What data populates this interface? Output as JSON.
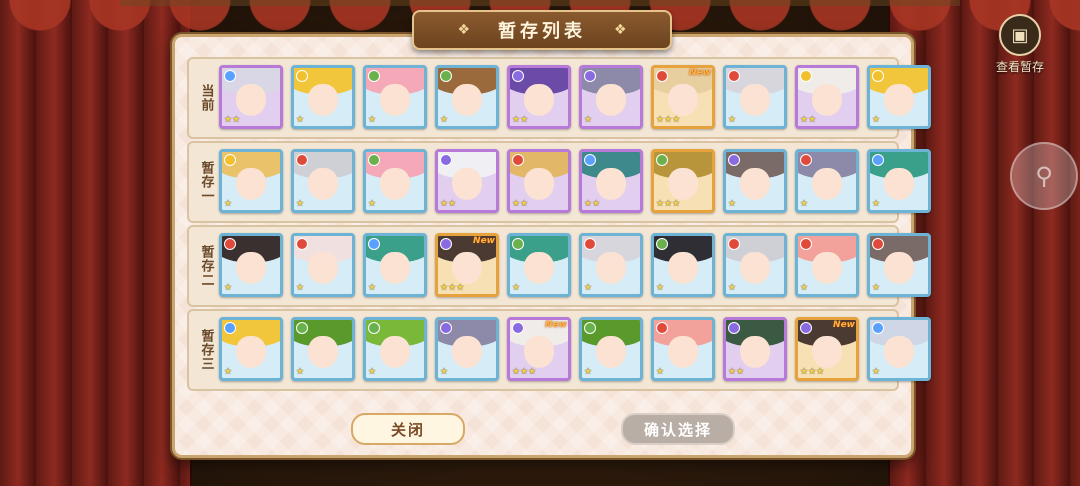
{
  "title": "暂存列表",
  "corner_button": {
    "label": "查看暂存",
    "icon": "storage-box-icon"
  },
  "float_button": {
    "icon": "lock-icon"
  },
  "rows": [
    {
      "label": "当前",
      "cards": [
        {
          "rarity": "purple",
          "element": "#5aa0ff",
          "hair": "#d9d6e6",
          "stars": "★★",
          "new": ""
        },
        {
          "rarity": "blue",
          "element": "#f2c02c",
          "hair": "#f1c63a",
          "stars": "★",
          "new": ""
        },
        {
          "rarity": "blue",
          "element": "#6ab04c",
          "hair": "#f4a8b8",
          "stars": "★",
          "new": ""
        },
        {
          "rarity": "blue",
          "element": "#6ab04c",
          "hair": "#9b6a3c",
          "stars": "★",
          "new": ""
        },
        {
          "rarity": "purple",
          "element": "#8a6ae0",
          "hair": "#6b4aa8",
          "stars": "★★",
          "new": ""
        },
        {
          "rarity": "purple",
          "element": "#8a6ae0",
          "hair": "#8c8aa8",
          "stars": "★",
          "new": ""
        },
        {
          "rarity": "gold",
          "element": "#e04a3a",
          "hair": "#e8cfa0",
          "stars": "★★★",
          "new": "New"
        },
        {
          "rarity": "blue",
          "element": "#e04a3a",
          "hair": "#d6d6dc",
          "stars": "★",
          "new": ""
        },
        {
          "rarity": "purple",
          "element": "#f2c02c",
          "hair": "#f0ecea",
          "stars": "★★",
          "new": ""
        },
        {
          "rarity": "blue",
          "element": "#f2c02c",
          "hair": "#f1c63a",
          "stars": "★",
          "new": ""
        }
      ]
    },
    {
      "label": "暂存一",
      "cards": [
        {
          "rarity": "blue",
          "element": "#f2c02c",
          "hair": "#e9c26a",
          "stars": "★",
          "new": ""
        },
        {
          "rarity": "blue",
          "element": "#e04a3a",
          "hair": "#cfcfd6",
          "stars": "★",
          "new": ""
        },
        {
          "rarity": "blue",
          "element": "#6ab04c",
          "hair": "#f4a8b8",
          "stars": "★",
          "new": ""
        },
        {
          "rarity": "purple",
          "element": "#8a6ae0",
          "hair": "#f0f0f4",
          "stars": "★★",
          "new": ""
        },
        {
          "rarity": "purple",
          "element": "#e04a3a",
          "hair": "#e2b868",
          "stars": "★★",
          "new": ""
        },
        {
          "rarity": "purple",
          "element": "#5aa0ff",
          "hair": "#3e8a8a",
          "stars": "★★",
          "new": ""
        },
        {
          "rarity": "gold",
          "element": "#6ab04c",
          "hair": "#b8943a",
          "stars": "★★★",
          "new": ""
        },
        {
          "rarity": "blue",
          "element": "#8a6ae0",
          "hair": "#7a6a68",
          "stars": "★",
          "new": ""
        },
        {
          "rarity": "blue",
          "element": "#e04a3a",
          "hair": "#8c8aa8",
          "stars": "★",
          "new": ""
        },
        {
          "rarity": "blue",
          "element": "#5aa0ff",
          "hair": "#3aa08a",
          "stars": "★",
          "new": ""
        }
      ]
    },
    {
      "label": "暂存二",
      "cards": [
        {
          "rarity": "blue",
          "element": "#e04a3a",
          "hair": "#3a3030",
          "stars": "★",
          "new": ""
        },
        {
          "rarity": "blue",
          "element": "#e04a3a",
          "hair": "#f0e0e0",
          "stars": "★",
          "new": ""
        },
        {
          "rarity": "blue",
          "element": "#5aa0ff",
          "hair": "#3aa08a",
          "stars": "★",
          "new": ""
        },
        {
          "rarity": "gold",
          "element": "#8a6ae0",
          "hair": "#4a3a32",
          "stars": "★★★",
          "new": "New"
        },
        {
          "rarity": "blue",
          "element": "#6ab04c",
          "hair": "#3aa08a",
          "stars": "★",
          "new": ""
        },
        {
          "rarity": "blue",
          "element": "#e04a3a",
          "hair": "#d6d6dc",
          "stars": "★",
          "new": ""
        },
        {
          "rarity": "blue",
          "element": "#6ab04c",
          "hair": "#2e2e34",
          "stars": "★",
          "new": ""
        },
        {
          "rarity": "blue",
          "element": "#e04a3a",
          "hair": "#cfcfd6",
          "stars": "★",
          "new": ""
        },
        {
          "rarity": "blue",
          "element": "#e04a3a",
          "hair": "#f2a29a",
          "stars": "★",
          "new": ""
        },
        {
          "rarity": "blue",
          "element": "#e04a3a",
          "hair": "#7a6a68",
          "stars": "★",
          "new": ""
        }
      ]
    },
    {
      "label": "暂存三",
      "cards": [
        {
          "rarity": "blue",
          "element": "#5aa0ff",
          "hair": "#f1c63a",
          "stars": "★",
          "new": ""
        },
        {
          "rarity": "blue",
          "element": "#6ab04c",
          "hair": "#5a9a2c",
          "stars": "★",
          "new": ""
        },
        {
          "rarity": "blue",
          "element": "#6ab04c",
          "hair": "#7ab83a",
          "stars": "★",
          "new": ""
        },
        {
          "rarity": "blue",
          "element": "#8a6ae0",
          "hair": "#8c8aa8",
          "stars": "★",
          "new": ""
        },
        {
          "rarity": "purple",
          "element": "#8a6ae0",
          "hair": "#f0ecea",
          "stars": "★★★",
          "new": "New"
        },
        {
          "rarity": "blue",
          "element": "#6ab04c",
          "hair": "#5a9a2c",
          "stars": "★",
          "new": ""
        },
        {
          "rarity": "blue",
          "element": "#e04a3a",
          "hair": "#f2a29a",
          "stars": "★",
          "new": ""
        },
        {
          "rarity": "purple",
          "element": "#8a6ae0",
          "hair": "#3a5a44",
          "stars": "★★",
          "new": ""
        },
        {
          "rarity": "gold",
          "element": "#8a6ae0",
          "hair": "#4a3a32",
          "stars": "★★★",
          "new": "New"
        },
        {
          "rarity": "blue",
          "element": "#5aa0ff",
          "hair": "#cfd6e6",
          "stars": "★",
          "new": ""
        }
      ]
    }
  ],
  "buttons": {
    "close": "关闭",
    "confirm": "确认选择"
  },
  "colors": {
    "panel_bg": "#f6e3d7",
    "title_bg": "#7a4e26",
    "rare_blue": "#6db3d6",
    "rare_purple": "#b77ad8",
    "rare_gold": "#e6a23c"
  }
}
